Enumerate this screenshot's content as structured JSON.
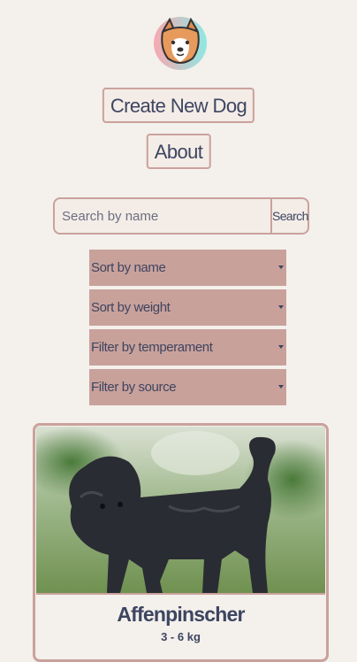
{
  "header": {
    "logo_icon": "dog-face-icon",
    "create_label": "Create New Dog",
    "about_label": "About"
  },
  "search": {
    "placeholder": "Search by name",
    "button_label": "Search"
  },
  "filters": {
    "sort_name": "Sort by name",
    "sort_weight": "Sort by weight",
    "filter_temperament": "Filter by temperament",
    "filter_source": "Filter by source"
  },
  "cards": [
    {
      "name": "Affenpinscher",
      "weight": "3 - 6 kg"
    }
  ],
  "colors": {
    "background": "#f4f0ec",
    "accent": "#caa29b",
    "text": "#3d4560"
  }
}
